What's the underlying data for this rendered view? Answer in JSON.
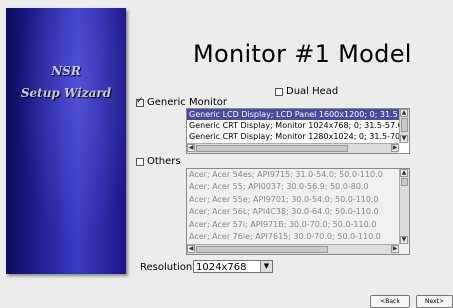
{
  "sidebar": {
    "brand_line1": "NSR",
    "brand_line2": "Setup Wizard"
  },
  "page": {
    "title": "Monitor #1 Model"
  },
  "options": {
    "dual_head": {
      "label": "Dual Head",
      "checked": false
    },
    "generic_monitor": {
      "label": "Generic Monitor",
      "checked": true
    },
    "others": {
      "label": "Others",
      "checked": false
    }
  },
  "generic_list": {
    "items": [
      "Generic LCD Display; LCD Panel 1600x1200; 0; 31.5",
      "Generic CRT Display; Monitor 1024x768; 0; 31.5-57.0",
      "Generic CRT Display; Monitor 1280x1024; 0; 31.5-70"
    ],
    "selected_index": 0
  },
  "others_list": {
    "items": [
      "Acer; Acer 54es; API9715; 31.0-54.0; 50.0-110.0",
      "Acer; Acer 55; API0037; 30.0-56.9; 50.0-80.0",
      "Acer; Acer 55e; API9701; 30.0-54.0; 50.0-110.0",
      "Acer; Acer 56L; API4C38; 30.0-64.0; 50.0-110.0",
      "Acer; Acer 57i; API971B; 30.0-70.0; 50.0-110.0",
      "Acer; Acer 76ie; API7615; 30.0-70.0; 50.0-110.0"
    ]
  },
  "resolution": {
    "label": "Resolution",
    "value": "1024x768"
  },
  "buttons": {
    "back": "<Back",
    "next": "Next>"
  },
  "icons": {
    "dropdown": "chevron-down-icon",
    "scroll_up": "arrow-up-icon",
    "scroll_down": "arrow-down-icon",
    "scroll_left": "arrow-left-icon",
    "scroll_right": "arrow-right-icon"
  }
}
